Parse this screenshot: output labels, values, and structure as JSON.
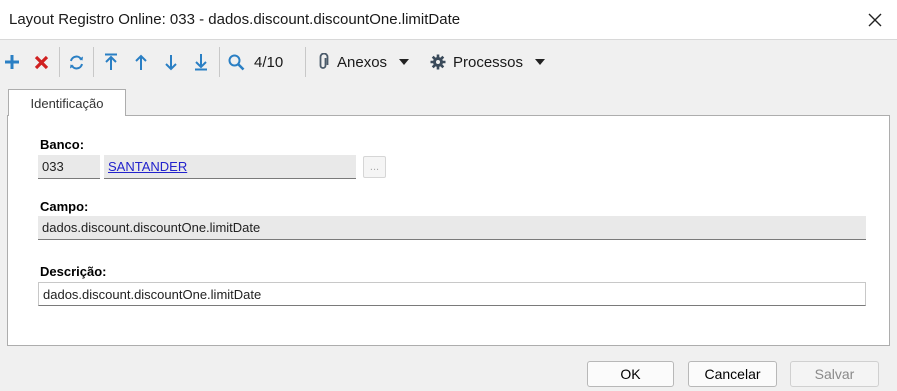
{
  "window": {
    "title": "Layout Registro Online: 033 - dados.discount.discountOne.limitDate"
  },
  "toolbar": {
    "record_counter": "4/10",
    "attachments_label": "Anexos",
    "processes_label": "Processos"
  },
  "colors": {
    "add": "#2a7fc4",
    "delete": "#d02020",
    "nav": "#2a7fc4",
    "link": "#2222cc"
  },
  "tabs": [
    {
      "label": "Identificação"
    }
  ],
  "form": {
    "banco": {
      "label": "Banco:",
      "code": "033",
      "name": "SANTANDER",
      "lookup_label": "..."
    },
    "campo": {
      "label": "Campo:",
      "value": "dados.discount.discountOne.limitDate"
    },
    "descricao": {
      "label": "Descrição:",
      "value": "dados.discount.discountOne.limitDate"
    }
  },
  "buttons": {
    "ok": "OK",
    "cancel": "Cancelar",
    "save": "Salvar"
  }
}
